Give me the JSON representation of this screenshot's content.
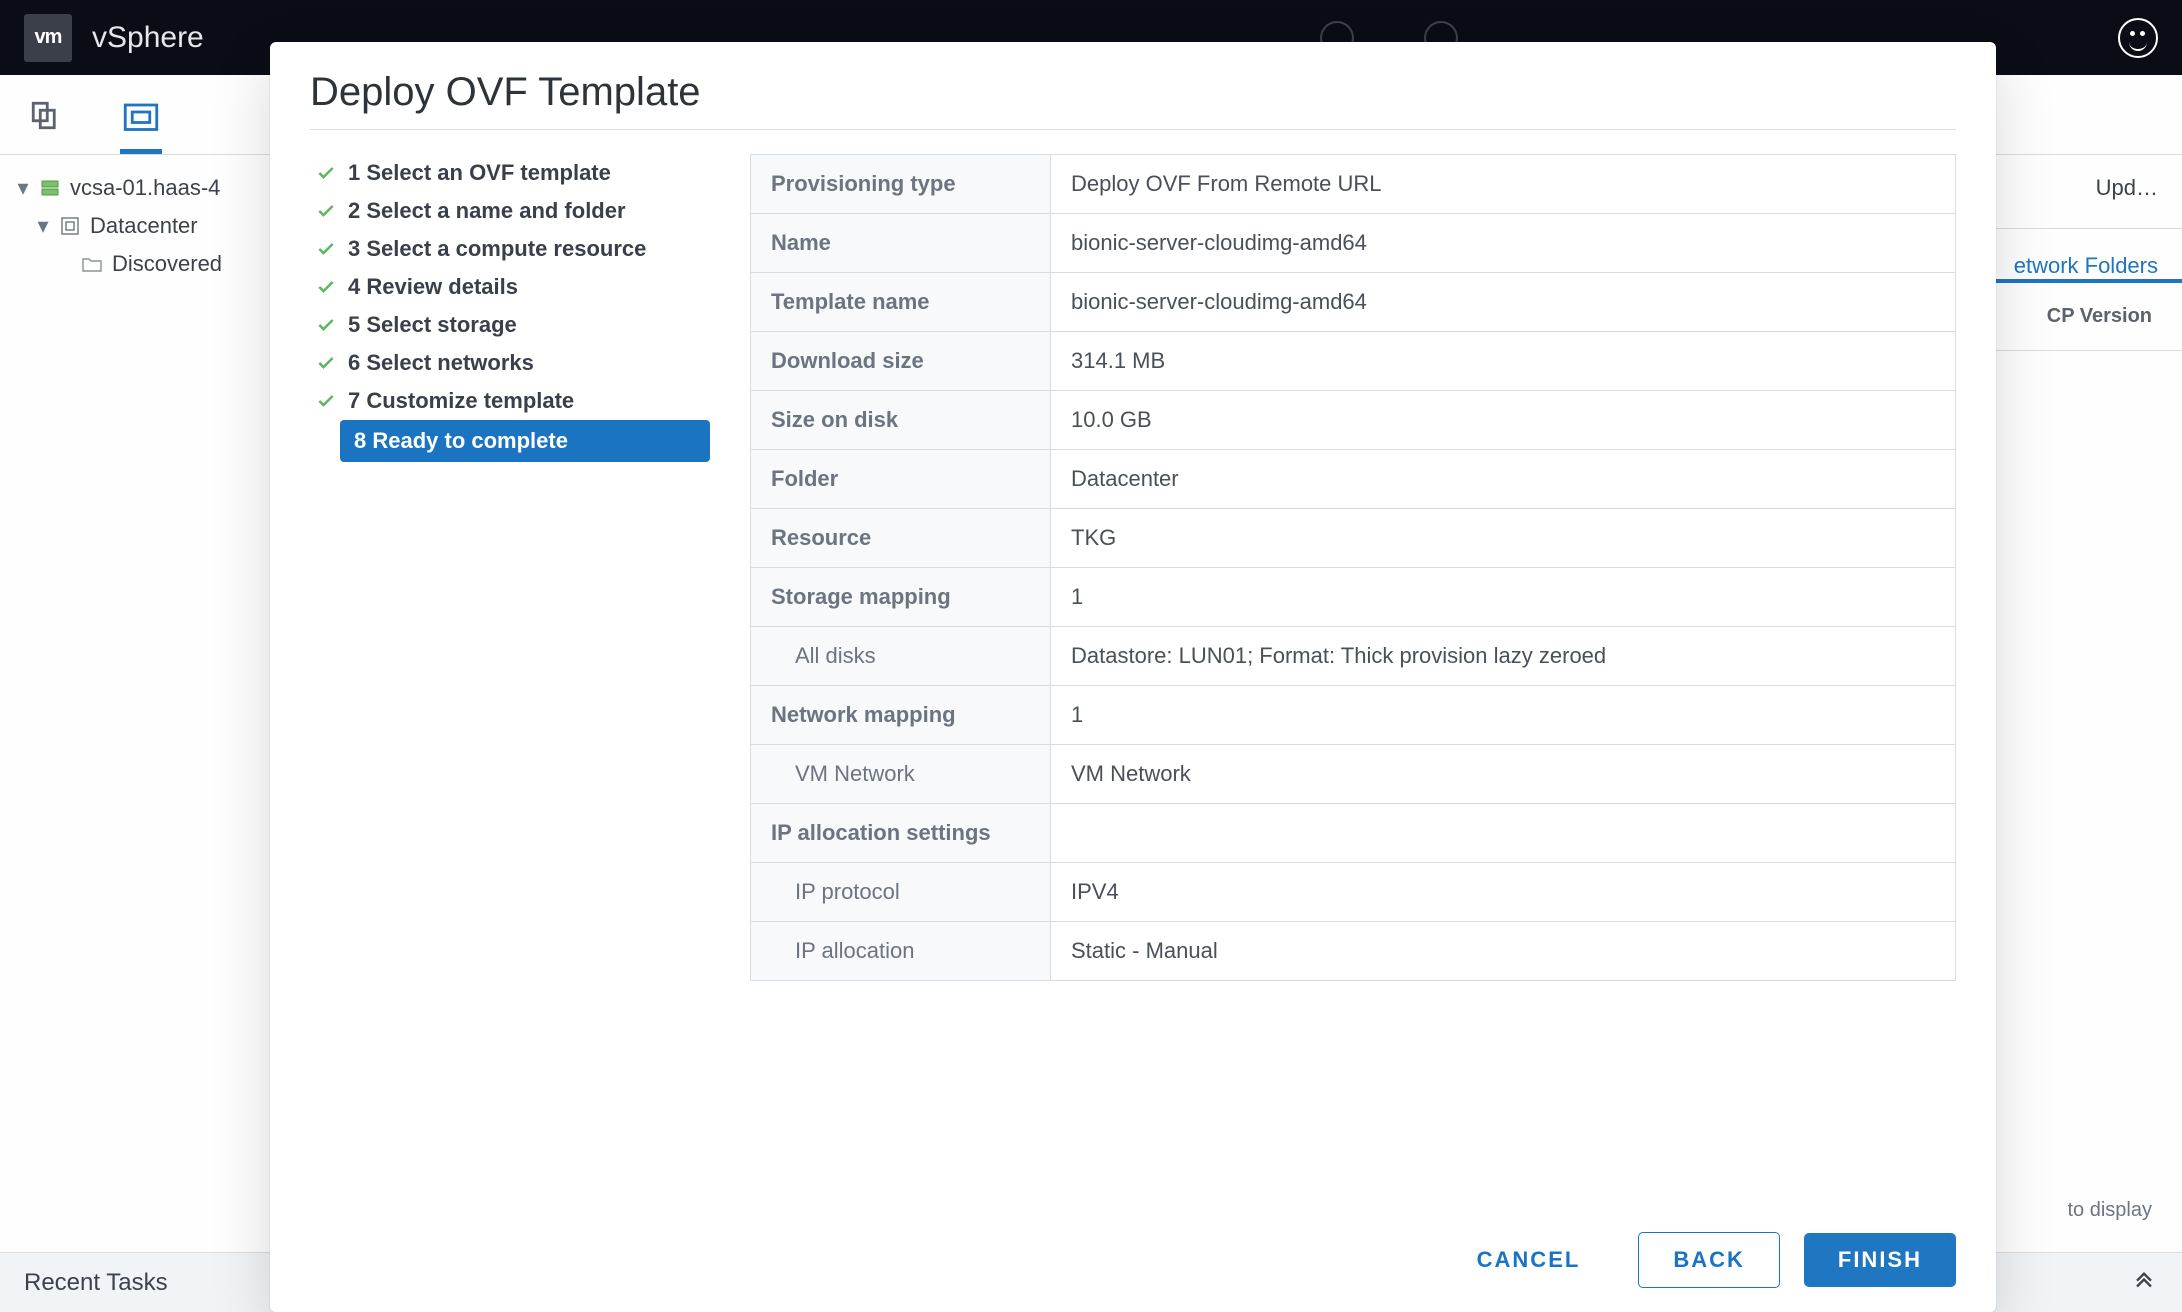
{
  "header": {
    "vm_badge": "vm",
    "brand": "vSphere"
  },
  "background": {
    "tree": {
      "root": "vcsa-01.haas-4",
      "datacenter": "Datacenter",
      "discovered": "Discovered"
    },
    "secondary_tabs": {
      "updates_truncated": "Upd…"
    },
    "lower_tab_truncated_network_folders": "etwork Folders",
    "table_header_truncated": "CP Version",
    "no_items_truncated": "to display"
  },
  "dialog": {
    "title": "Deploy OVF Template",
    "steps": [
      "1 Select an OVF template",
      "2 Select a name and folder",
      "3 Select a compute resource",
      "4 Review details",
      "5 Select storage",
      "6 Select networks",
      "7 Customize template"
    ],
    "current_step": "8 Ready to complete",
    "summary": {
      "provisioning_type_k": "Provisioning type",
      "provisioning_type_v": "Deploy OVF From Remote URL",
      "name_k": "Name",
      "name_v": "bionic-server-cloudimg-amd64",
      "template_name_k": "Template name",
      "template_name_v": "bionic-server-cloudimg-amd64",
      "download_size_k": "Download size",
      "download_size_v": "314.1 MB",
      "size_on_disk_k": "Size on disk",
      "size_on_disk_v": "10.0 GB",
      "folder_k": "Folder",
      "folder_v": "Datacenter",
      "resource_k": "Resource",
      "resource_v": "TKG",
      "storage_mapping_k": "Storage mapping",
      "storage_mapping_v": "1",
      "all_disks_k": "All disks",
      "all_disks_v": "Datastore: LUN01; Format: Thick provision lazy zeroed",
      "network_mapping_k": "Network mapping",
      "network_mapping_v": "1",
      "vm_network_k": "VM Network",
      "vm_network_v": "VM Network",
      "ip_alloc_k": "IP allocation settings",
      "ip_alloc_v": "",
      "ip_protocol_k": "IP protocol",
      "ip_protocol_v": "IPV4",
      "ip_allocation_k": "IP allocation",
      "ip_allocation_v": "Static - Manual"
    },
    "buttons": {
      "cancel": "CANCEL",
      "back": "BACK",
      "finish": "FINISH"
    }
  },
  "tasks": {
    "title": "Recent Tasks"
  }
}
